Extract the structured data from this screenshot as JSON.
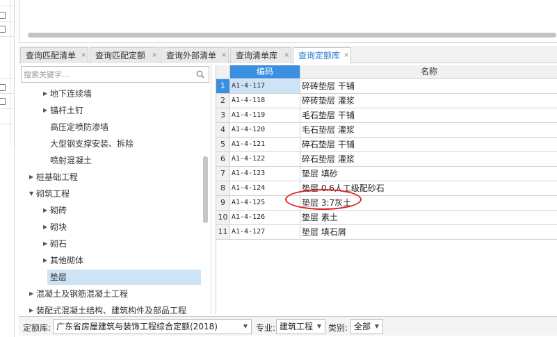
{
  "tabs": [
    {
      "label": "查询匹配清单",
      "active": false
    },
    {
      "label": "查询匹配定额",
      "active": false
    },
    {
      "label": "查询外部清单",
      "active": false
    },
    {
      "label": "查询清单库",
      "active": false
    },
    {
      "label": "查询定额库",
      "active": true
    }
  ],
  "tab_close_glyph": "×",
  "search": {
    "placeholder": "搜索关键字..."
  },
  "tree": {
    "items": [
      {
        "label": "地下连续墙",
        "arrow": "right"
      },
      {
        "label": "锚杆土钉",
        "arrow": "right"
      },
      {
        "label": "高压定喷防渗墙",
        "arrow": "none"
      },
      {
        "label": "大型钢支撑安装、拆除",
        "arrow": "none"
      },
      {
        "label": "喷射混凝土",
        "arrow": "none"
      },
      {
        "label": "桩基础工程",
        "arrow": "right"
      },
      {
        "label": "砌筑工程",
        "arrow": "down"
      },
      {
        "label": "砌砖",
        "arrow": "right"
      },
      {
        "label": "砌块",
        "arrow": "right"
      },
      {
        "label": "砌石",
        "arrow": "right"
      },
      {
        "label": "其他砌体",
        "arrow": "right"
      },
      {
        "label": "垫层",
        "arrow": "none",
        "selected": true
      },
      {
        "label": "混凝土及钢筋混凝土工程",
        "arrow": "right"
      },
      {
        "label": "装配式混凝土结构、建筑构件及部品工程",
        "arrow": "right"
      }
    ]
  },
  "grid": {
    "headers": {
      "code": "编码",
      "name": "名称"
    },
    "rows": [
      {
        "num": "1",
        "code": "A1-4-117",
        "name": "碎砖垫层 干铺",
        "selected": true
      },
      {
        "num": "2",
        "code": "A1-4-118",
        "name": "碎砖垫层 灌浆"
      },
      {
        "num": "3",
        "code": "A1-4-119",
        "name": "毛石垫层 干铺"
      },
      {
        "num": "4",
        "code": "A1-4-120",
        "name": "毛石垫层 灌浆"
      },
      {
        "num": "5",
        "code": "A1-4-121",
        "name": "碎石垫层 干铺"
      },
      {
        "num": "6",
        "code": "A1-4-122",
        "name": "碎石垫层 灌浆"
      },
      {
        "num": "7",
        "code": "A1-4-123",
        "name": "垫层 填砂"
      },
      {
        "num": "8",
        "code": "A1-4-124",
        "name": "垫层 0.6人工级配砂石"
      },
      {
        "num": "9",
        "code": "A1-4-125",
        "name": "垫层 3:7灰土"
      },
      {
        "num": "10",
        "code": "A1-4-126",
        "name": "垫层 素土"
      },
      {
        "num": "11",
        "code": "A1-4-127",
        "name": "垫层 填石屑"
      }
    ]
  },
  "bottom": {
    "quota_label": "定额库:",
    "quota_value": "广东省房屋建筑与装饰工程综合定额(2018)",
    "major_label": "专业:",
    "major_value": "建筑工程",
    "category_label": "类别:",
    "category_value": "全部"
  },
  "colors": {
    "accent": "#2a7bd4",
    "header_blue": "#3b8fe0",
    "selected_bg": "#cde4f7",
    "annotation": "#e02020"
  }
}
